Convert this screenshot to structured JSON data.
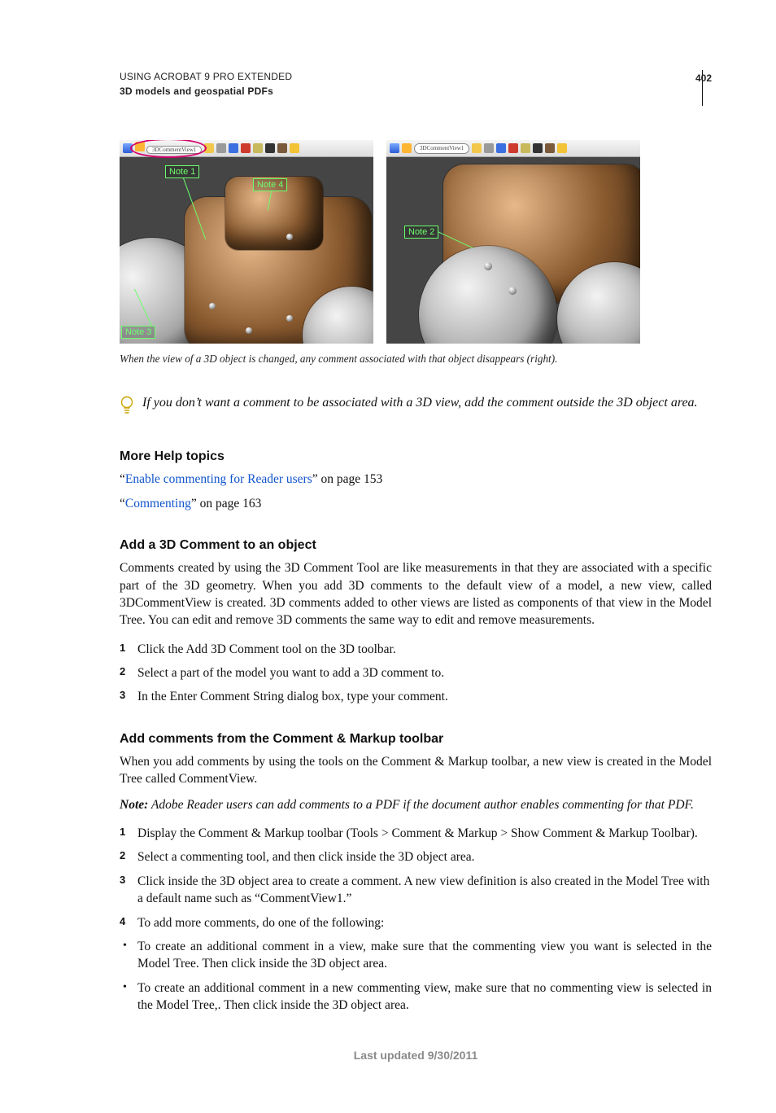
{
  "header": {
    "line1": "USING ACROBAT 9 PRO EXTENDED",
    "line2": "3D models and geospatial PDFs",
    "page_number": "402"
  },
  "figure": {
    "toolbar": {
      "dropdown": "3DCommentView1"
    },
    "notes": {
      "n1": "Note 1",
      "n2": "Note 2",
      "n3": "Note 3",
      "n4": "Note 4"
    },
    "caption": "When the view of a 3D object is changed, any comment associated with that object disappears (right)."
  },
  "tip": "If you don’t want a comment to be associated with a 3D view, add the comment outside the 3D object area.",
  "more_help": {
    "heading": "More Help topics",
    "items": [
      {
        "quote_open": "“",
        "link": "Enable commenting for Reader users",
        "suffix": "” on page 153"
      },
      {
        "quote_open": "“",
        "link": "Commenting",
        "suffix": "” on page 163"
      }
    ]
  },
  "section1": {
    "heading": "Add a 3D Comment to an object",
    "para": "Comments created by using the 3D Comment Tool are like measurements in that they are associated with a specific part of the 3D geometry. When you add 3D comments to the default view of a model, a new view, called 3DCommentView is created. 3D comments added to other views are listed as components of that view in the Model Tree. You can edit and remove 3D comments the same way to edit and remove measurements.",
    "steps": [
      "Click the Add 3D Comment tool on the 3D toolbar.",
      "Select a part of the model you want to add a 3D comment to.",
      "In the Enter Comment String dialog box, type your comment."
    ]
  },
  "section2": {
    "heading": "Add comments from the Comment & Markup toolbar",
    "para": "When you add comments by using the tools on the Comment & Markup toolbar, a new view is created in the Model Tree called CommentView.",
    "note_label": "Note:",
    "note_text": " Adobe Reader users can add comments to a PDF if the document author enables commenting for that PDF.",
    "steps": [
      "Display the Comment & Markup toolbar (Tools > Comment & Markup > Show Comment & Markup Toolbar).",
      "Select a commenting tool, and then click inside the 3D object area.",
      "Click inside the 3D object area to create a comment. A new view definition is also created in the Model Tree with a default name such as “CommentView1.”",
      "To add more comments, do one of the following:"
    ],
    "bullets": [
      "To create an additional comment in a view, make sure that the commenting view you want is selected in the Model Tree. Then click inside the 3D object area.",
      "To create an additional comment in a new commenting view, make sure that no commenting view is selected in the Model Tree,. Then click inside the 3D object area."
    ]
  },
  "footer": "Last updated 9/30/2011"
}
